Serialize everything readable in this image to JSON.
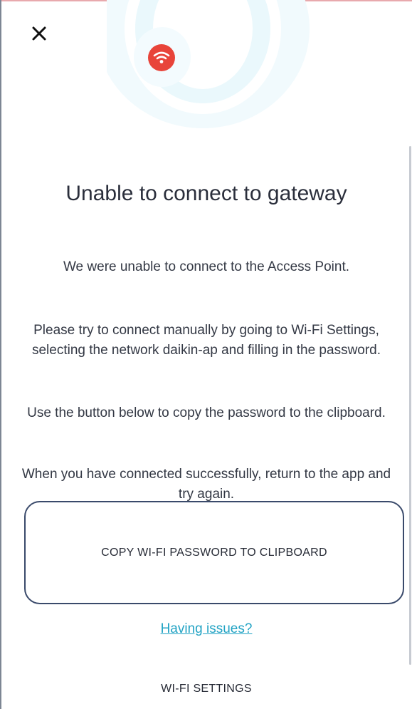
{
  "header": {
    "close_icon": "close-icon"
  },
  "illustration": {
    "icon": "wifi-icon",
    "badge_color": "#e8443a",
    "ring_color": "#e6f7fb"
  },
  "dialog": {
    "title": "Unable to connect to gateway",
    "messages": [
      "We were unable to connect to the Access Point.",
      "Please try to connect manually by going to Wi-Fi Settings, selecting the network daikin-ap and filling in the password.",
      "Use the button below to copy the password to the clipboard.",
      "When you have connected successfully, return to the app and try again."
    ]
  },
  "actions": {
    "copy_button": "COPY WI-FI PASSWORD TO CLIPBOARD",
    "help_link": "Having issues?",
    "wifi_settings": "WI-FI SETTINGS"
  },
  "colors": {
    "link": "#22a3c4",
    "button_border": "#3a4a6b",
    "text": "#2b2f3a"
  }
}
